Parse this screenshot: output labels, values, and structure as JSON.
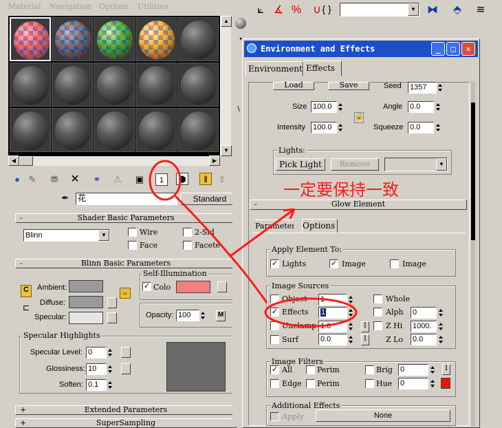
{
  "material_editor": {
    "menu": [
      "Material",
      "Navigation",
      "Options",
      "Utilities"
    ],
    "material_name": "花",
    "material_type": "Standard",
    "shader_basic": {
      "title": "Shader Basic Parameters",
      "shader": "Blinn",
      "wire": "Wire",
      "two_sided": "2-Sid",
      "face": "Face",
      "faceted": "Facete"
    },
    "blinn_basic": {
      "title": "Blinn Basic Parameters",
      "self_illum_title": "Self-Illumination",
      "ambient": "Ambient:",
      "diffuse": "Diffuse:",
      "specular": "Specular:",
      "color": "Colo",
      "opacity_label": "Opacity:",
      "opacity": "100",
      "opacity_map": "M",
      "ambient_lock": "C"
    },
    "specular_highlights": {
      "title": "Specular Highlights",
      "level_label": "Specular Level:",
      "level": "0",
      "gloss_label": "Glossiness:",
      "gloss": "10",
      "soften_label": "Soften:",
      "soften": "0.1"
    },
    "extended": "Extended Parameters",
    "supersampling": "SuperSampling"
  },
  "env_dialog": {
    "title": "Environment and Effects",
    "tabs": [
      "Environment",
      "Effects"
    ],
    "load": "Load",
    "save": "Save",
    "seed_label": "Seed",
    "seed": "1357",
    "size_label": "Size",
    "size": "100.0",
    "angle_label": "Angle",
    "angle": "0.0",
    "intensity_label": "Intensity",
    "intensity": "100.0",
    "squeeze_label": "Squeeze",
    "squeeze": "0.0",
    "lights_title": "Lights:",
    "pick_light": "Pick Light",
    "remove": "Remove",
    "glow_title": "Glow Element",
    "sub_tabs": [
      "Parameters",
      "Options"
    ],
    "apply_title": "Apply Element To:",
    "apply_lights": "Lights",
    "apply_image": "Image",
    "apply_image_centers": "Image",
    "sources_title": "Image Sources",
    "object": "Object",
    "object_val": "1",
    "whole": "Whole",
    "effects": "Effects",
    "effects_val": "1",
    "alpha": "Alph",
    "alpha_val": "0",
    "unclamp": "Unclamp",
    "unclamp_val": "1.0",
    "z_hi": "Z Hi",
    "z_hi_val": "1000.",
    "surf": "Surf",
    "surf_val": "0.0",
    "z_lo": "Z Lo",
    "z_lo_val": "0.0",
    "filters_title": "Image Filters",
    "all": "All",
    "perim_alpha": "Perim",
    "bright": "Brig",
    "bright_val": "0",
    "edge": "Edge",
    "perim": "Perim",
    "hue": "Hue",
    "hue_val": "0",
    "hue_color": "#ee1111",
    "additional_title": "Additional Effects",
    "apply": "Apply",
    "none": "None",
    "invert": "I"
  },
  "annotation": "一定要保持一致",
  "colors": {
    "self_illum": "#f08080",
    "ambient": "#9a9a9a",
    "diffuse": "#9a9a9a",
    "specular": "#e6e6e6",
    "annotation": "#ff1a1a",
    "titlebar": "#1c4ec8"
  }
}
